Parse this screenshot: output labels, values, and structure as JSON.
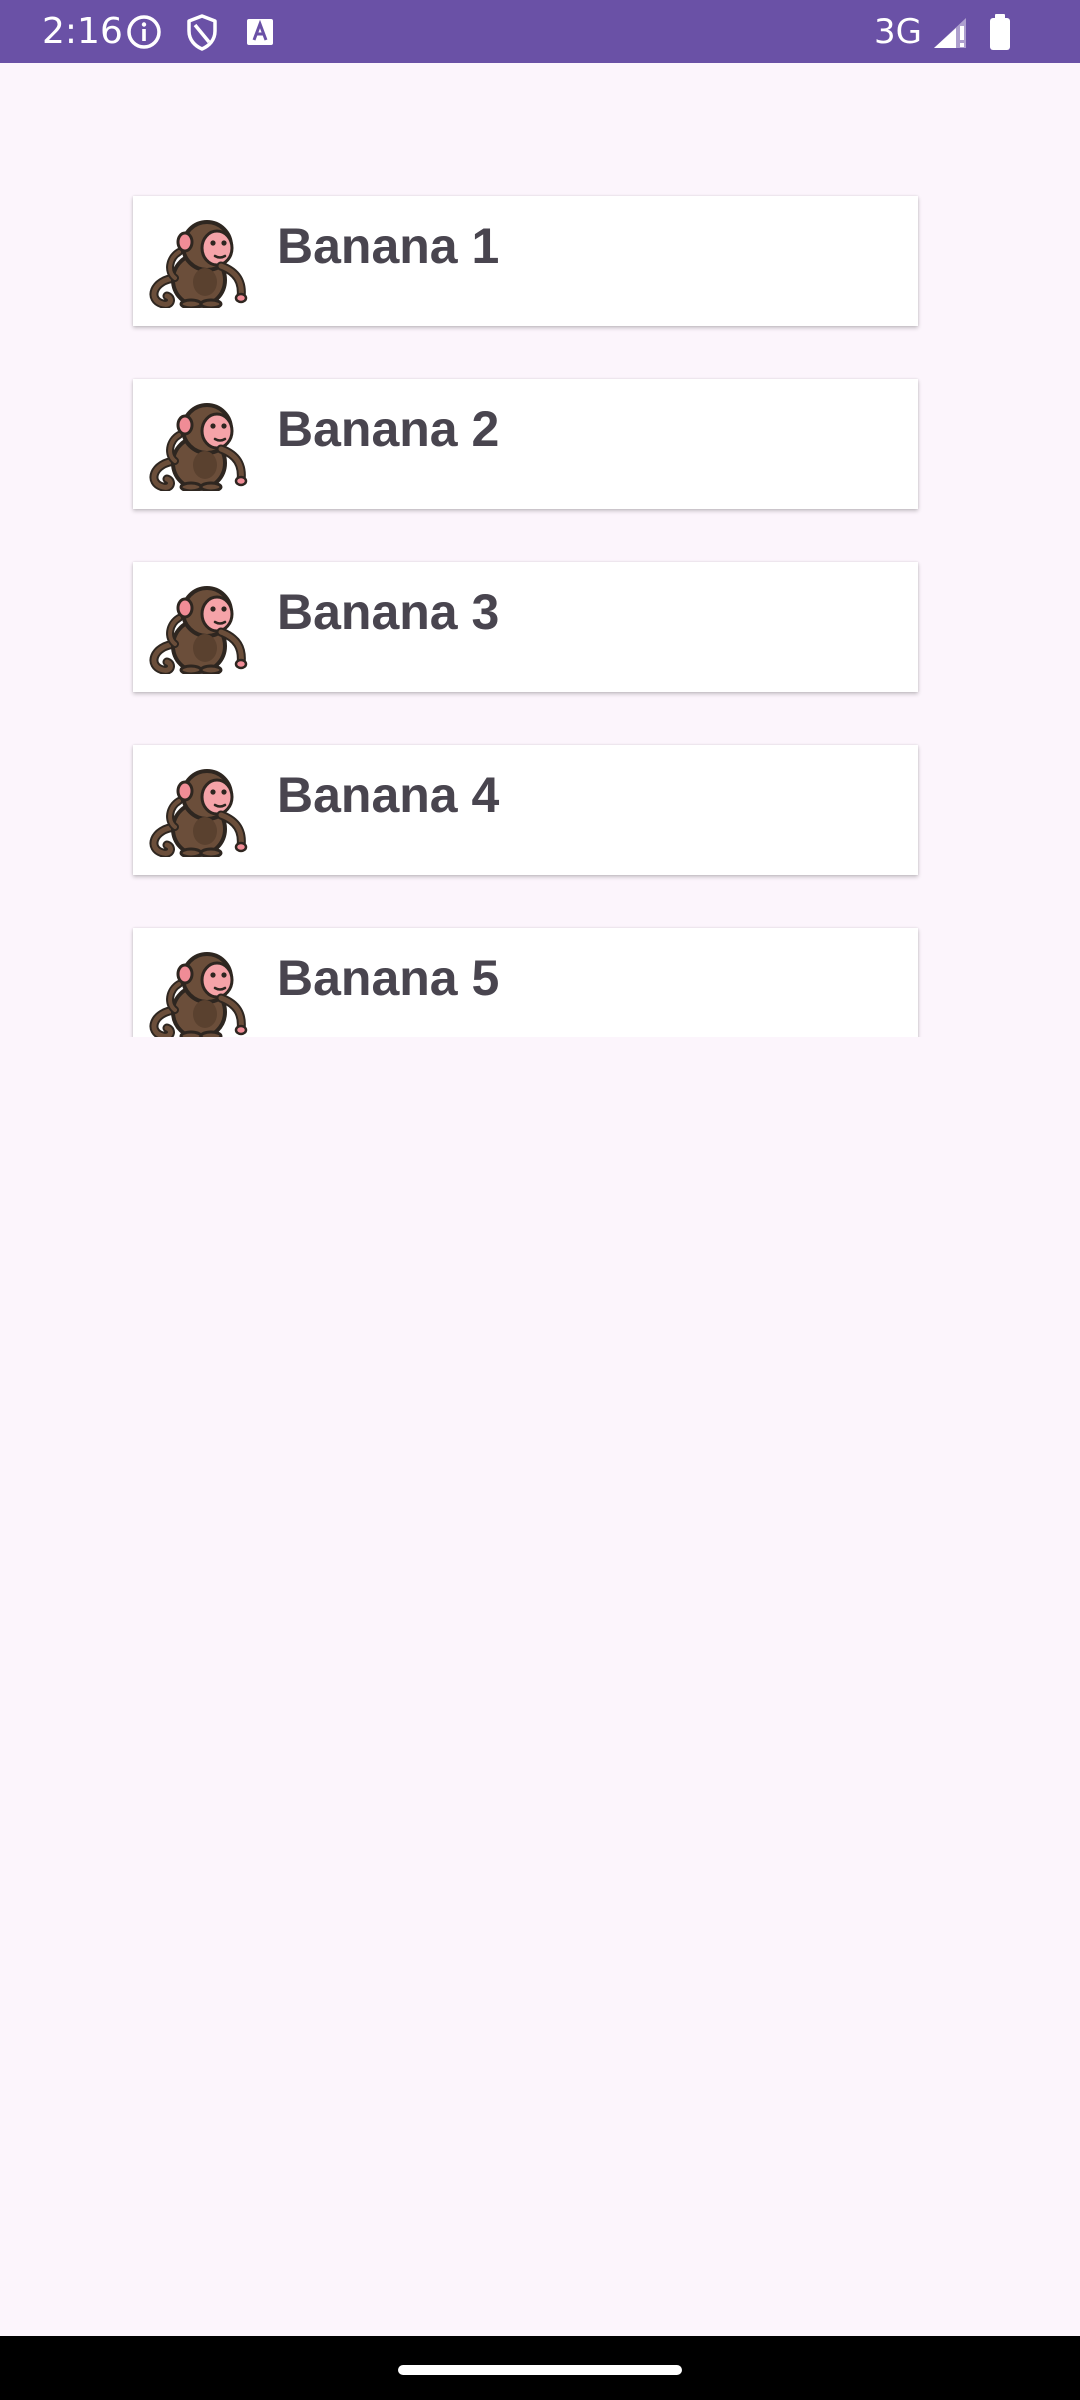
{
  "status_bar": {
    "time": "2:16",
    "network": "3G",
    "icons": [
      "info-icon",
      "shield-icon",
      "keyboard-a-icon",
      "signal-icon",
      "battery-icon"
    ],
    "background": "#6A51A6"
  },
  "list": {
    "items": [
      {
        "label": "Banana 1",
        "icon": "monkey-icon"
      },
      {
        "label": "Banana 2",
        "icon": "monkey-icon"
      },
      {
        "label": "Banana 3",
        "icon": "monkey-icon"
      },
      {
        "label": "Banana 4",
        "icon": "monkey-icon"
      },
      {
        "label": "Banana 5",
        "icon": "monkey-icon"
      }
    ]
  },
  "colors": {
    "background": "#FCF5FC",
    "card": "#FFFFFF",
    "text": "#49454F"
  }
}
